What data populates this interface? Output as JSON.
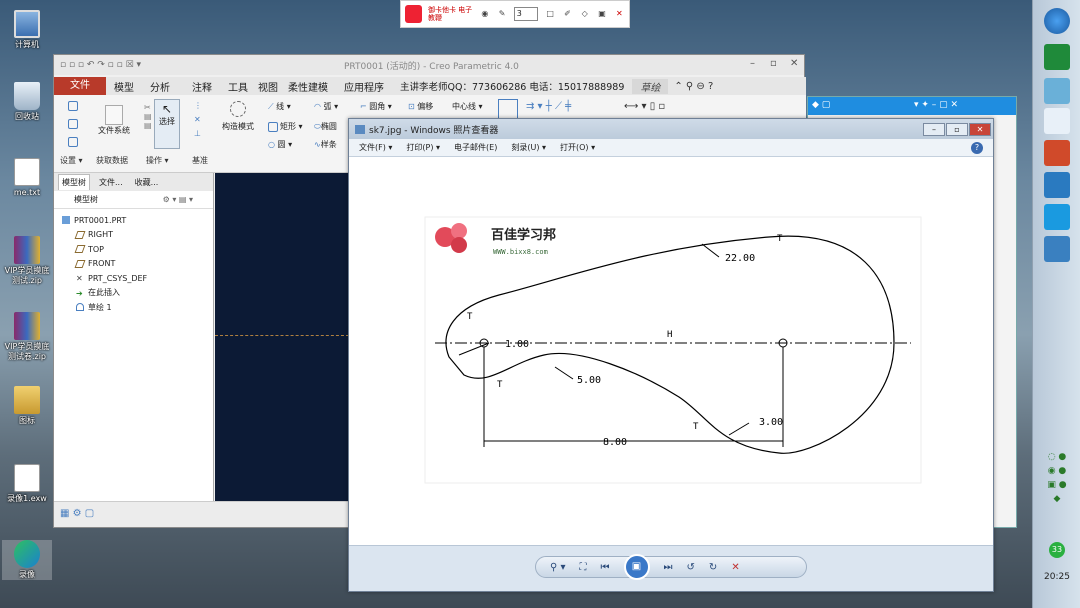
{
  "desktop": {
    "icons": [
      {
        "label": "计算机"
      },
      {
        "label": "回收站"
      },
      {
        "label": "me.txt"
      },
      {
        "label": "VIP学员摸底测试.zip"
      },
      {
        "label": "VIP学员摸底测试卷.zip"
      },
      {
        "label": "图标"
      },
      {
        "label": "录像1.exw"
      },
      {
        "label": "录像"
      }
    ]
  },
  "floatbar": {
    "title": "御卡他卡 电子教鞭",
    "page_value": "3"
  },
  "creo": {
    "title": "PRT0001 (活动的) - Creo Parametric 4.0",
    "menu": [
      "文件",
      "模型",
      "分析",
      "注释",
      "工具",
      "视图",
      "柔性建模",
      "应用程序"
    ],
    "info": "主讲李老师QQ：773606286 电话：15017888989",
    "sketch_tab": "草绘",
    "ribbon": {
      "file_system": "文件系统",
      "select": "选择",
      "construct_mode": "构造模式",
      "line": "线",
      "arc": "弧",
      "rect": "矩形",
      "circle": "圆",
      "ellipse": "椭圆",
      "spline": "样条",
      "fillet": "圆角",
      "offset": "偏移",
      "centerline": "中心线",
      "groups": [
        "设置",
        "获取数据",
        "操作",
        "基准"
      ]
    },
    "tree_tabs": [
      "模型树",
      "文件...",
      "收藏..."
    ],
    "tree_header": "模型树",
    "tree": [
      "PRT0001.PRT",
      "RIGHT",
      "TOP",
      "FRONT",
      "PRT_CSYS_DEF",
      "在此插入",
      "草绘 1"
    ]
  },
  "viewer": {
    "title": "sk7.jpg - Windows 照片查看器",
    "menu": [
      "文件(F)",
      "打印(P)",
      "电子邮件(E)",
      "刻录(U)",
      "打开(O)"
    ],
    "brand_name": "百佳学习邦",
    "brand_url": "WWW.bixx8.com"
  },
  "chart_data": {
    "type": "table",
    "title": "",
    "dimensions": [
      "22.00",
      "1.00",
      "5.00",
      "3.00",
      "8.00"
    ],
    "labels": [
      "T",
      "T",
      "T",
      "T",
      "H"
    ]
  },
  "taskbar": {
    "clock": "20:25",
    "badge": "33"
  }
}
